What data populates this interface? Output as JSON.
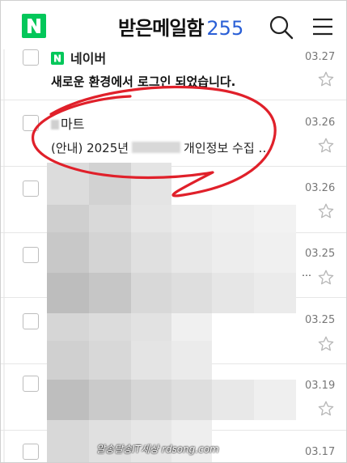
{
  "header": {
    "logo_letter": "N",
    "title": "받은메일함",
    "unread_count": "255"
  },
  "mails": [
    {
      "sender": "네이버",
      "subject": "새로운 환경에서 로그인 되었습니다.",
      "date": "03.27",
      "unread": true
    },
    {
      "sender": "마트",
      "subject_prefix": "(안내) 2025년",
      "subject_suffix": "개인정보 수집 …",
      "date": "03.26",
      "unread": false
    },
    {
      "sender": "",
      "subject": "",
      "date": "03.26"
    },
    {
      "sender": "",
      "subject": "",
      "date": "03.25"
    },
    {
      "sender": "",
      "subject": "",
      "date": "03.25"
    },
    {
      "sender": "",
      "subject": "",
      "date": "03.19"
    },
    {
      "sender": "",
      "subject": "",
      "date": "03.17"
    }
  ],
  "watermark": "알송달송IT세상 rdsong.com",
  "colors": {
    "brand_green": "#03c75a",
    "count_blue": "#2a5fd6",
    "annotation_red": "#e0202a"
  }
}
